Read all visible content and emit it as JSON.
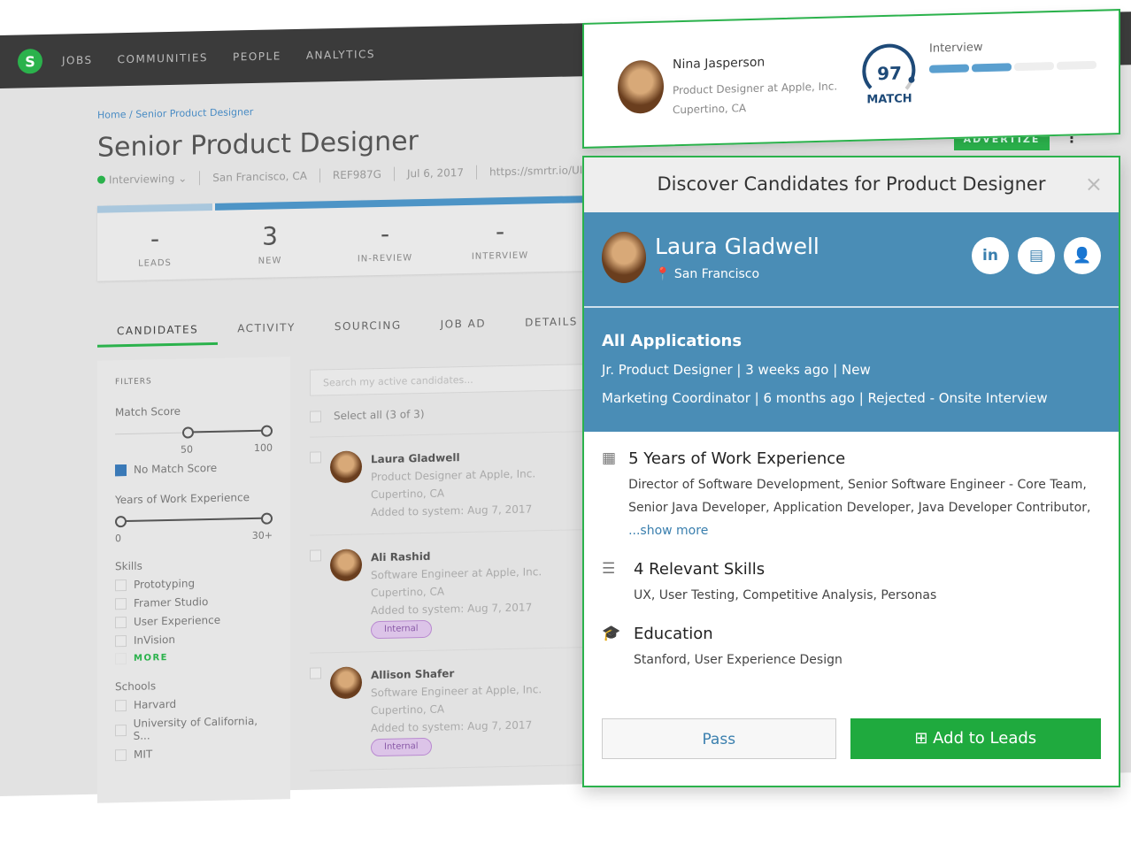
{
  "nav": {
    "logo": "S",
    "items": [
      "JOBS",
      "COMMUNITIES",
      "PEOPLE",
      "ANALYTICS"
    ]
  },
  "breadcrumb": {
    "home": "Home",
    "sep": "/",
    "current": "Senior Product Designer"
  },
  "job": {
    "title": "Senior Product Designer",
    "status": "Interviewing",
    "location": "San Francisco, CA",
    "ref": "REF987G",
    "date": "Jul 6, 2017",
    "url": "https://smrtr.io/UIO"
  },
  "pipeline": [
    {
      "value": "-",
      "label": "LEADS"
    },
    {
      "value": "3",
      "label": "NEW"
    },
    {
      "value": "-",
      "label": "IN-REVIEW"
    },
    {
      "value": "-",
      "label": "INTERVIEW"
    }
  ],
  "tabs": [
    "CANDIDATES",
    "ACTIVITY",
    "SOURCING",
    "JOB AD",
    "DETAILS"
  ],
  "filters": {
    "heading": "FILTERS",
    "match_label": "Match Score",
    "match_min": "50",
    "match_max": "100",
    "no_match": "No Match Score",
    "years_label": "Years of Work Experience",
    "years_min": "0",
    "years_max": "30+",
    "skills_label": "Skills",
    "skills": [
      "Prototyping",
      "Framer Studio",
      "User Experience",
      "InVision"
    ],
    "more": "MORE",
    "schools_label": "Schools",
    "schools": [
      "Harvard",
      "University of California, S...",
      "MIT"
    ]
  },
  "list": {
    "search_placeholder": "Search my active candidates...",
    "select_all": "Select all (3 of 3)",
    "candidates": [
      {
        "name": "Laura Gladwell",
        "title": "Product Designer at Apple, Inc.",
        "location": "Cupertino, CA",
        "added": "Added to system: Aug 7, 2017",
        "badge": ""
      },
      {
        "name": "Ali Rashid",
        "title": "Software Engineer at Apple, Inc.",
        "location": "Cupertino, CA",
        "added": "Added to system: Aug 7, 2017",
        "badge": "Internal"
      },
      {
        "name": "Allison Shafer",
        "title": "Software Engineer at Apple, Inc.",
        "location": "Cupertino, CA",
        "added": "Added to system: Aug 7, 2017",
        "badge": "Internal"
      }
    ]
  },
  "card": {
    "name": "Nina Jasperson",
    "title": "Product Designer at Apple, Inc.",
    "location": "Cupertino, CA",
    "match": "97",
    "match_label": "MATCH",
    "stage": "Interview",
    "stage_progress": 0.5
  },
  "advertize": "ADVERTIZE",
  "modal": {
    "title": "Discover Candidates for Product Designer",
    "close": "×",
    "name": "Laura Gladwell",
    "location": "San Francisco",
    "apps_heading": "All Applications",
    "apps": [
      [
        "Jr. Product Designer",
        "3 weeks ago",
        "New"
      ],
      [
        "Marketing Coordinator",
        "6 months ago",
        "Rejected - Onsite Interview"
      ]
    ],
    "exp_heading": "5 Years of Work Experience",
    "exp_text": "Director of Software Development, Senior Software Engineer - Core Team, Senior Java Developer, Application Developer, Java Developer Contributor,",
    "show_more": "...show more",
    "skills_heading": "4 Relevant Skills",
    "skills_text": "UX, User Testing, Competitive Analysis, Personas",
    "edu_heading": "Education",
    "edu_text": "Stanford, User Experience Design",
    "pass": "Pass",
    "add": "Add to Leads"
  },
  "colors": {
    "accent": "#2bb24c",
    "blue": "#4a8db6",
    "nav": "#3b3b3b"
  }
}
